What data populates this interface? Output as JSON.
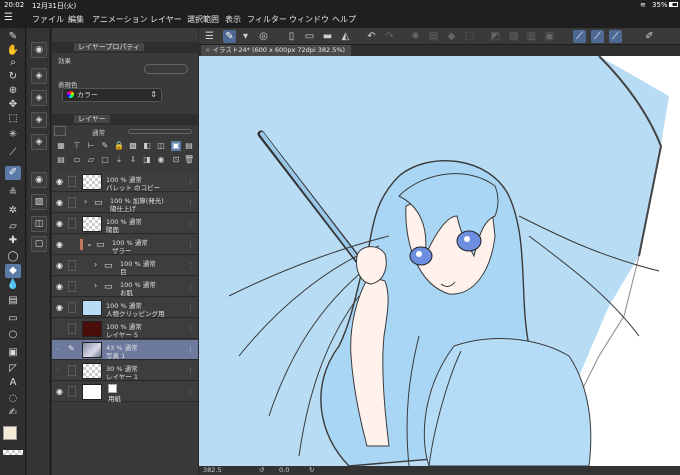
{
  "status": {
    "time": "20:02",
    "date": "12月31日(火)",
    "battery": "35%"
  },
  "menu": [
    "ファイル",
    "編集",
    "アニメーション",
    "レイヤー",
    "選択範囲",
    "表示",
    "フィルター",
    "ウィンドウ",
    "ヘルプ"
  ],
  "property_panel": {
    "title": "レイヤープロパティ",
    "section_effect": "効果",
    "section_expression": "表現色",
    "expression_value": "カラー"
  },
  "layer_panel": {
    "title": "レイヤー",
    "blend_mode": "通常",
    "layers": [
      {
        "line1": "100 % 通常",
        "line2": "パレット のコピー"
      },
      {
        "line1": "100 % 加算(発光)",
        "line2": "陽仕上げ"
      },
      {
        "line1": "100 % 通常",
        "line2": "陽面"
      },
      {
        "line1": "100 % 通常",
        "line2": "ザラー"
      },
      {
        "line1": "100 % 通常",
        "line2": "目"
      },
      {
        "line1": "100 % 通常",
        "line2": "お肌"
      },
      {
        "line1": "100 % 通常",
        "line2": "人物クリッピング用"
      },
      {
        "line1": "100 % 通常",
        "line2": "レイヤー 5"
      },
      {
        "line1": "43 % 通常",
        "line2": "写真 1"
      },
      {
        "line1": "30 % 通常",
        "line2": "レイヤー 1"
      },
      {
        "line1": "100 % 通常",
        "line2": "用紙"
      }
    ]
  },
  "document": {
    "tab_label": "イラスト24* (600 x 600px 72dpi 382.5%)"
  },
  "bottom": {
    "zoom": "382.5",
    "rotation": "0.0"
  },
  "colors": {
    "accent": "#5a7ba8",
    "canvas_bg": "#b7dcf4",
    "selected_layer": "#6d7a9e"
  }
}
